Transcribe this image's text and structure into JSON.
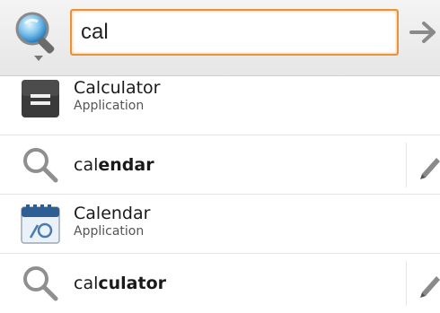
{
  "search": {
    "query": "cal",
    "source_icon": "magnifier-globe-icon",
    "go_icon": "arrow-right-icon"
  },
  "suggestions": [
    {
      "kind": "application",
      "icon": "calculator-app-icon",
      "title": "Calculator",
      "subtitle": "Application"
    },
    {
      "kind": "query",
      "icon": "search-icon",
      "typed": "cal",
      "completion": "endar",
      "action_icon": "pencil-icon"
    },
    {
      "kind": "application",
      "icon": "calendar-app-icon",
      "title": "Calendar",
      "subtitle": "Application"
    },
    {
      "kind": "query",
      "icon": "search-icon",
      "typed": "cal",
      "completion": "culator",
      "action_icon": "pencil-icon"
    }
  ],
  "colors": {
    "focus_border": "#e8923a",
    "bar_background": "#eeeeee",
    "text": "#1a1a1a"
  }
}
